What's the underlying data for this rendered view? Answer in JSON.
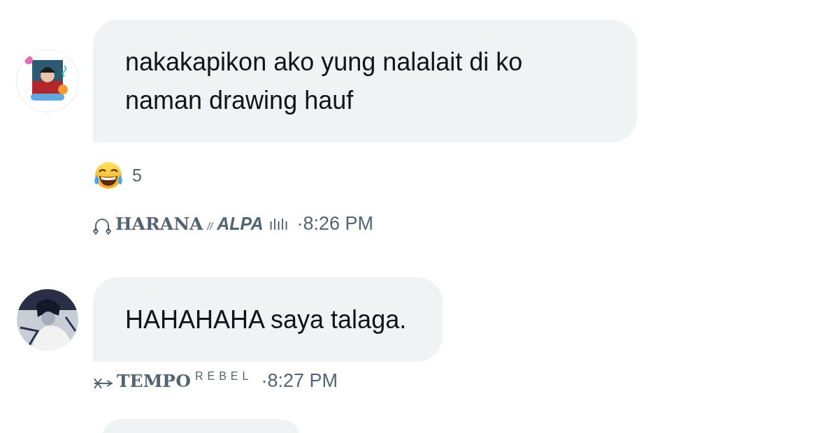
{
  "messages": [
    {
      "text": "nakakapikon ako yung nalalait di ko naman drawing hauf",
      "reactions": [
        {
          "count": "5"
        }
      ],
      "sender": [
        {
          "kind": "headphones"
        },
        {
          "kind": "serif",
          "text": "HARANA"
        },
        {
          "kind": "small",
          "text": "//"
        },
        {
          "kind": "italic",
          "text": "ALPA"
        },
        {
          "kind": "thin",
          "text": "ılılı"
        }
      ],
      "time": "·8:26 PM"
    },
    {
      "text": "HAHAHAHA saya talaga.",
      "sender": [
        {
          "kind": "arrow"
        },
        {
          "kind": "serif",
          "text": "TEMPO"
        },
        {
          "kind": "sup",
          "text": "REBEL"
        }
      ],
      "time": "·8:27 PM"
    },
    {
      "kind": "cut"
    }
  ]
}
